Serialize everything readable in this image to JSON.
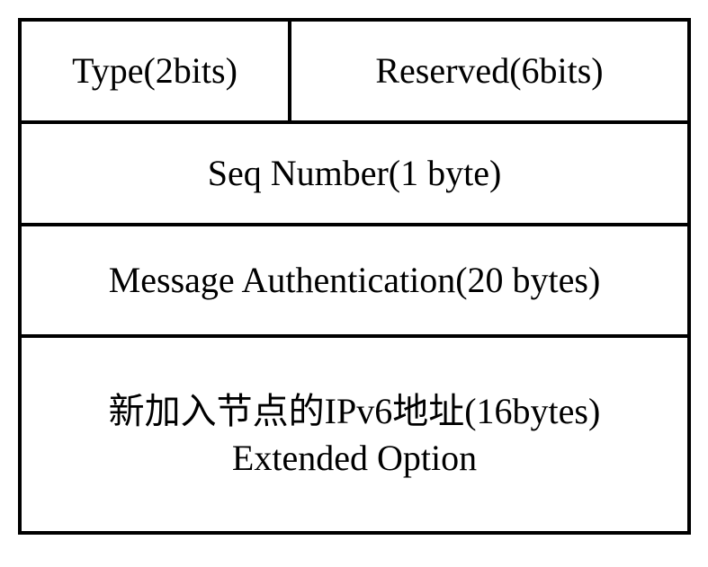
{
  "packet": {
    "row1": {
      "type": "Type(2bits)",
      "reserved": "Reserved(6bits)"
    },
    "row2": "Seq Number(1 byte)",
    "row3": "Message Authentication(20 bytes)",
    "row4": {
      "line1": "新加入节点的IPv6地址(16bytes)",
      "line2": "Extended Option"
    }
  }
}
